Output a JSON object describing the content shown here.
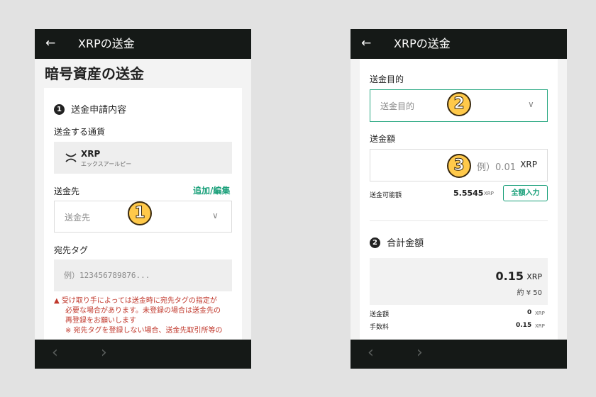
{
  "app": {
    "title": "XRPの送金",
    "back_icon": "←"
  },
  "bottom_nav": {
    "back": "‹",
    "forward": "›"
  },
  "screen1": {
    "page_title": "暗号資産の送金",
    "section1_num": "1",
    "section1_title": "送金申請内容",
    "currency_label": "送金する通貨",
    "currency_symbol": "XRP",
    "currency_kana": "エックスアールピー",
    "dest_label": "送金先",
    "dest_link": "追加/編集",
    "dest_placeholder": "送金先",
    "tag_label": "宛先タグ",
    "tag_placeholder": "例）123456789876...",
    "warning_icon": "▲",
    "warning_line1": "受け取り手によっては送金時に宛先タグの指定が",
    "warning_line2": "必要な場合があります。未登録の場合は送金先の",
    "warning_line3": "再登録をお願いします",
    "warning_line4": "※ 宛先タグを登録しない場合、送金先取引所等の",
    "callout": "1"
  },
  "screen2": {
    "purpose_label": "送金目的",
    "purpose_placeholder": "送金目的",
    "amount_label": "送金額",
    "amount_placeholder": "例）0.01",
    "amount_unit": "XRP",
    "available_label": "送金可能額",
    "available_value": "5.5545",
    "available_unit": "XRP",
    "full_button": "全額入力",
    "section2_num": "2",
    "section2_title": "合計金額",
    "total_value": "0.15",
    "total_unit": "XRP",
    "total_yen": "約 ¥ 50",
    "row1_label": "送金額",
    "row1_value": "0",
    "row1_unit": "XRP",
    "row2_label": "手数料",
    "row2_value": "0.15",
    "row2_unit": "XRP",
    "callout2": "2",
    "callout3": "3"
  }
}
